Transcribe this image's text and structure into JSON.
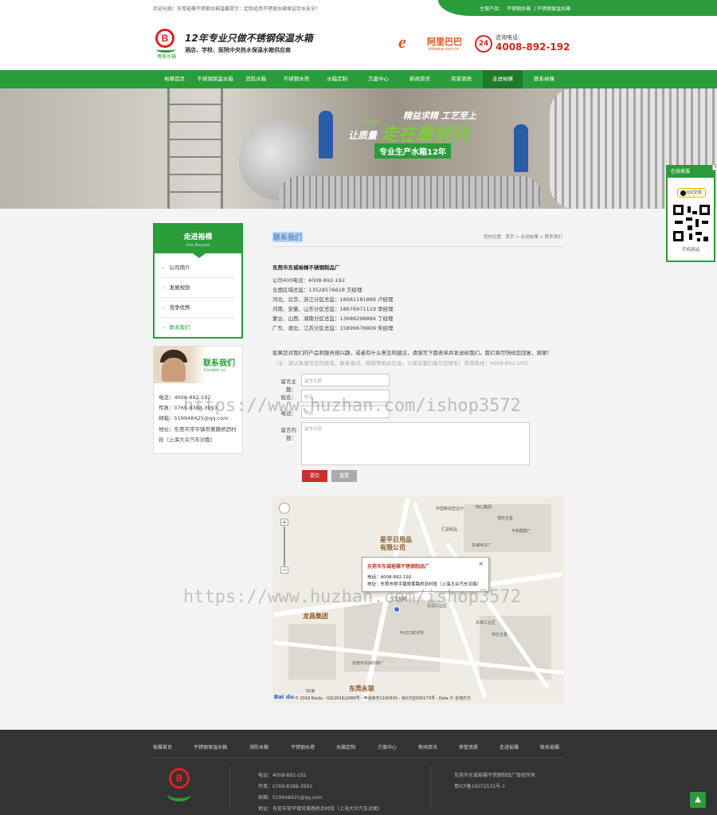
{
  "topbar": {
    "welcome": "欢迎光临：东莞裕棵不锈钢水箱温馨提示：定制适用不锈钢水箱保证饮水安全！",
    "products_label": "主营产品：",
    "product1": "不锈钢水箱",
    "product2": "| 不锈钢保温水箱"
  },
  "header": {
    "logo_text": "博英水箱",
    "logo_mark": "B",
    "slogan_years": "12年",
    "slogan_main": "专业只做不锈钢保温水箱",
    "slogan_sub": "酒店、学校、医院中央热水保温水箱供应商",
    "alibaba_cn": "阿里巴巴",
    "alibaba_en": "Alibaba.com.cn",
    "hotline_badge": "24",
    "hotline_label": "咨询电话：",
    "hotline_number": "4008-892-192"
  },
  "nav": [
    "裕棵首页",
    "不锈钢保温水箱",
    "消防水箱",
    "不锈钢水塔",
    "水箱定制",
    "方案中心",
    "新闻资讯",
    "荣誉资质",
    "走进裕棵",
    "联系裕棵"
  ],
  "nav_active_index": 8,
  "banner": {
    "line1": "精益求精 工艺至上",
    "quality": "quality",
    "line2a": "让质量",
    "line2b": "走在最前列",
    "line3": "专业生产水箱12年"
  },
  "sidebar": {
    "title": "走进裕棵",
    "subtitle": "Into Boyuan",
    "items": [
      "公司简介",
      "发展规划",
      "竞争优势",
      "联系我们"
    ],
    "current_index": 3,
    "contact_title": "联系我们",
    "contact_sub": "Contact us",
    "contact_lines": [
      "电话：4008-892-192",
      "传真：0769-8388-3993",
      "邮箱：519948425@qq.com",
      "地址：东莞市常平镇常黄路桥沥村",
      "段（上海大众汽车对面）"
    ]
  },
  "main": {
    "title": "联系我们",
    "breadcrumb": "您的位置：首页 > 走进裕棵 > 联系我们",
    "company": "东莞市东城裕棵不锈钢制品厂",
    "info_lines": [
      "公司400电话：4008-892-192",
      "全国区域总监：13528576618   方经理",
      "河北、北京、浙江分区总监：18681181889  卢经理",
      "河南、安徽、山东分区总监：18676971119  李经理",
      "蒙古、山西、湖南分区总监：13686298886  丁经理",
      "广东、湖北、江苏分区总监：15899676809  朱经理"
    ],
    "note1": "如果您对我们的产品和服务感兴趣，或者有什么意见和建议，请填写下面表单并发送给我们，我们将尽快给您回复，谢谢！",
    "note2": "（注：请认真填写您的姓名、联系电话、邮箱等相关信息，以保证我们能与您联系）咨询热线：4008-892-192）",
    "form": {
      "subject_label": "留言主题：",
      "subject_placeholder": "留言主题",
      "name_label": "姓名：",
      "name_placeholder": "姓名",
      "phone_label": "电话：",
      "phone_placeholder": "电话",
      "content_label": "留言内容：",
      "content_placeholder": "留言内容",
      "submit": "提交",
      "reset": "重置"
    }
  },
  "map": {
    "popup_title": "东莞市东城裕棵不锈钢制品厂",
    "popup_phone": "电话：4008-892-192",
    "popup_addr": "地址：东莞市常平镇常黄路桥沥村段（上海大众汽车对面）",
    "close": "×",
    "zoom_in": "+",
    "zoom_out": "−",
    "labels": [
      "中国移动营业厅",
      "田心集团",
      "恒旺五金",
      "汇益纸品",
      "平和塑胶厂",
      "东城电子厂",
      "东莞市东城印刷厂",
      "东莞永联",
      "东冠工业区",
      "恒生服装",
      "东城工业区",
      "伟达五金",
      "叶记口腔诊所"
    ],
    "big_labels": [
      "星平日用品\n有限公司",
      "龙昌集团",
      "东莞永联"
    ],
    "scale": "50米",
    "copyright": "© 2018 Baidu - GS(2016)2089号 - 甲测资字1100930 - 京ICP证030173号 - Data © 长地万方",
    "baidu": "Bai du"
  },
  "footer": {
    "nav": [
      "裕棵首页",
      "不锈钢保温水箱",
      "消防水箱",
      "不锈钢水塔",
      "水箱定制",
      "方案中心",
      "新闻资讯",
      "荣誉资质",
      "走进裕棵",
      "联系裕棵"
    ],
    "logo_mark": "B",
    "contact": [
      "电话：4008-892-192",
      "传真：0769-8388-3993",
      "邮箱：519948425@qq.com",
      "地址：东莞市常平镇常黄路桥沥村段（上海大众汽车对面）"
    ],
    "rights": "东莞市东城裕棵不锈钢制品厂版权所有",
    "icp": "粤ICP备16072531号-1",
    "totop": "▲"
  },
  "float_panel": {
    "title": "在线客服",
    "qq": "QQ交谈",
    "mobile": "手机网站",
    "close": "×"
  },
  "watermark": "https://www.huzhan.com/ishop3572",
  "colors": {
    "brand_green": "#2a9c3a",
    "accent_red": "#c9302c",
    "hotline_red": "#c82a1f"
  }
}
